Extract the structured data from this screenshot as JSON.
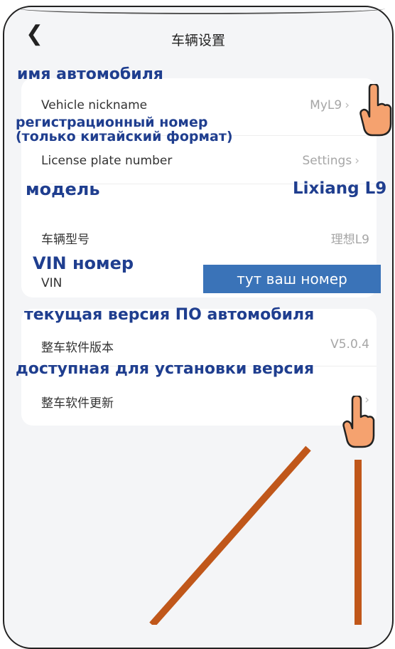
{
  "header": {
    "title": "车辆设置",
    "back_icon": "chevron-left-icon"
  },
  "card1": {
    "rows": [
      {
        "label": "Vehicle nickname",
        "value": "MyL9"
      },
      {
        "label": "License plate number",
        "value": "Settings"
      },
      {
        "label": "车辆型号",
        "value": "理想L9"
      },
      {
        "label": "VIN",
        "value": ""
      }
    ]
  },
  "card2": {
    "rows": [
      {
        "label": "整车软件版本",
        "value": "V5.0.4"
      },
      {
        "label": "整车软件更新",
        "value": ""
      }
    ]
  },
  "annotations": {
    "nickname": "имя автомобиля",
    "plate_line1": "регистрационный номер",
    "plate_line2": "(только китайский формат)",
    "model": "модель",
    "model_value": "Lixiang L9",
    "vin": "VIN номер",
    "vin_box": "тут ваш номер",
    "current_version": "текущая версия ПО автомобиля",
    "available_version": "доступная для установки версия"
  },
  "colors": {
    "annotation": "#1f3e8f",
    "vin_box": "#3a73b8",
    "arrow_line": "#c0571a",
    "hand_fill": "#f5a26f"
  }
}
